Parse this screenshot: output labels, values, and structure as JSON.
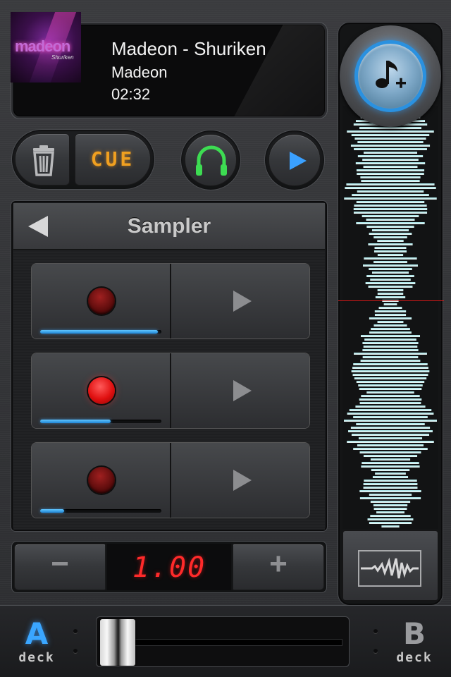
{
  "now_playing": {
    "title": "Madeon - Shuriken",
    "artist": "Madeon",
    "time": "02:32",
    "album_art": {
      "logo_text": "madeon",
      "sub_text": "Shuriken"
    }
  },
  "transport": {
    "trash_icon": "trash-icon",
    "cue_label": "CUE",
    "headphone_icon": "headphones-icon",
    "play_icon": "play-icon",
    "colors": {
      "cue": "#f0a020",
      "headphones": "#3ddc52",
      "play": "#3aa0ff"
    }
  },
  "sampler": {
    "title": "Sampler",
    "back_icon": "back-arrow-icon",
    "slots": [
      {
        "recording": false,
        "progress": 0.97
      },
      {
        "recording": true,
        "progress": 0.58
      },
      {
        "recording": false,
        "progress": 0.2
      }
    ]
  },
  "pitch": {
    "minus_label": "−",
    "value": "1.00",
    "plus_label": "+",
    "display_color": "#ff2a2a"
  },
  "waveform": {
    "add_music_icon": "add-music-icon",
    "overview_icon": "waveform-overview-icon",
    "colors": {
      "wave_top": "#9fe3e6",
      "wave_bottom": "#f2f7f7",
      "playhead": "#d01818"
    }
  },
  "decks": {
    "a": {
      "letter": "A",
      "word": "deck",
      "active": true
    },
    "b": {
      "letter": "B",
      "word": "deck",
      "active": false
    },
    "crossfader_position": 0.0
  }
}
